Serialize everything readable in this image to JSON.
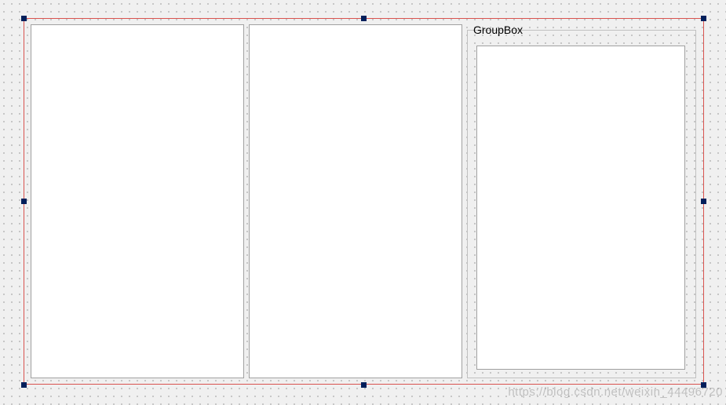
{
  "groupbox": {
    "title": "GroupBox"
  },
  "watermark": {
    "text": "https://blog.csdn.net/weixin_44496720"
  }
}
